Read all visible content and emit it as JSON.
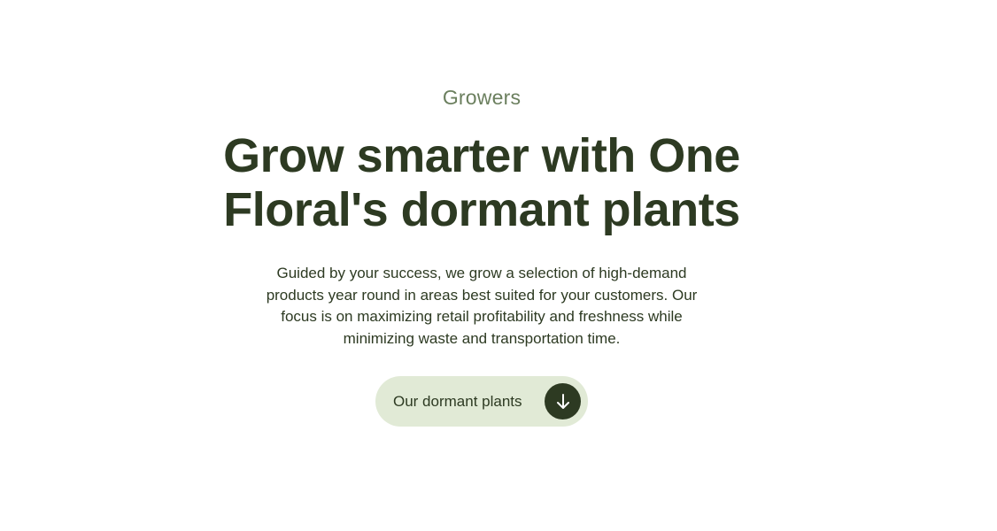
{
  "hero": {
    "eyebrow": "Growers",
    "headline": "Grow smarter with One Floral's dormant plants",
    "body": "Guided by your success, we grow a selection of high-demand products year round in areas best suited for your customers. Our focus is on maximizing retail profitability and freshness while minimizing waste and transportation time.",
    "cta": {
      "label": "Our dormant plants",
      "icon": "arrow-down-icon"
    }
  },
  "colors": {
    "heading": "#2d3a22",
    "eyebrow": "#6b7f5e",
    "button_bg": "#e1ead6",
    "icon_bg": "#2d3a22",
    "icon_fg": "#ffffff",
    "page_bg": "#ffffff"
  }
}
